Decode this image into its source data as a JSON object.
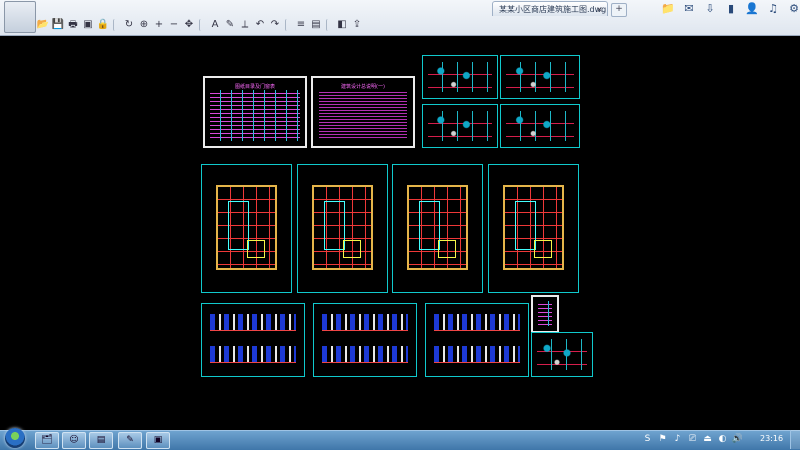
{
  "window": {
    "tab_title": "某某小区商店建筑施工图.dwg",
    "tab_close": "×",
    "tab_add": "+"
  },
  "toolbar": {
    "icons": [
      "open-icon",
      "save-icon",
      "print-icon",
      "pdf-icon",
      "lock-icon",
      "rotate-icon",
      "zoom-window-icon",
      "zoom-in-icon",
      "zoom-out-icon",
      "pan-icon",
      "text-icon",
      "pencil-icon",
      "measure-icon",
      "undo-icon",
      "redo-icon",
      "layers-icon",
      "layout-icon",
      "3d-icon",
      "export-icon"
    ],
    "glyphs": [
      "📂",
      "💾",
      "🖶",
      "▣",
      "🔒",
      "↻",
      "⊕",
      "+",
      "−",
      "✥",
      "A",
      "✎",
      "⟂",
      "↶",
      "↷",
      "≡",
      "▤",
      "◧",
      "⇪"
    ]
  },
  "top_right": {
    "glyphs": [
      "📁",
      "✉",
      "⇩",
      "▮",
      "👤",
      "♫",
      "⚙"
    ]
  },
  "drawing": {
    "sheet1_title": "图纸目录及门窗表",
    "sheet2_title": "建筑设计总说明(一)"
  },
  "taskbar": {
    "clock": "23:16",
    "tray_glyphs": [
      "S",
      "⚑",
      "♪",
      "⎚",
      "⏏",
      "◐",
      "🔊"
    ]
  },
  "colors": {
    "frame": "#10c9cc",
    "plan_wall": "#e5b54a",
    "grid": "#ee3838",
    "text_magenta": "#d33ad3"
  }
}
